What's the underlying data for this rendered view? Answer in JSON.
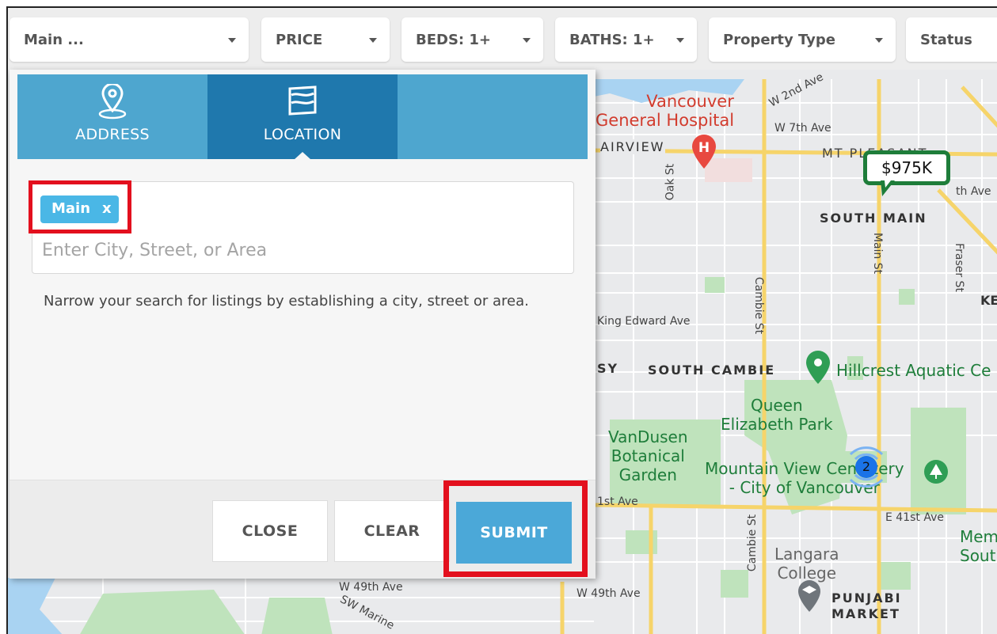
{
  "filters": {
    "location_label": "Main ...",
    "price_label": "PRICE",
    "beds_label": "BEDS: 1+",
    "baths_label": "BATHS: 1+",
    "property_type_label": "Property Type",
    "status_label": "Status"
  },
  "panel": {
    "tabs": [
      {
        "label": "ADDRESS",
        "icon": "map-pin-icon",
        "active": false
      },
      {
        "label": "LOCATION",
        "icon": "map-fold-icon",
        "active": true
      }
    ],
    "chip": {
      "label": "Main",
      "remove": "x"
    },
    "search_placeholder": "Enter City, Street, or Area",
    "help_text": "Narrow your search for listings by establishing a city, street or area.",
    "buttons": {
      "close": "CLOSE",
      "clear": "CLEAR",
      "submit": "SUBMIT"
    }
  },
  "map": {
    "labels": {
      "vgh_line1": "Vancouver",
      "vgh_line2": "General Hospital",
      "fairview": "AIRVIEW",
      "w2nd": "W 2nd Ave",
      "w7th": "W 7th Ave",
      "mt_pleasant": "MT PLEASANT",
      "oak_st": "Oak St",
      "south_main": "SOUTH MAIN",
      "th_ave": "th Ave",
      "main_st": "Main St",
      "fraser_st": "Fraser St",
      "ke": "KE",
      "cambie_st": "Cambie St",
      "king_edward": "King Edward Ave",
      "sy": "SY",
      "south_cambie": "SOUTH CAMBIE",
      "hillcrest": "Hillcrest Aquatic Ce",
      "queen_line1": "Queen",
      "queen_line2": "Elizabeth Park",
      "vandusen_line1": "VanDusen",
      "vandusen_line2": "Botanical",
      "vandusen_line3": "Garden",
      "mv_line1": "Mountain View Cemetery",
      "mv_line2": "- City of Vancouver",
      "st_ave": "1st Ave",
      "e41st": "E 41st Ave",
      "cambie_st2": "Cambie St",
      "langara_line1": "Langara",
      "langara_line2": "College",
      "mem": "Mem",
      "south": "South",
      "w49th_left": "W 49th Ave",
      "w49th_right": "W 49th Ave",
      "sw_marine": "SW Marine",
      "punjabi_line1": "PUNJABI",
      "punjabi_line2": "MARKET"
    },
    "price_pin": "$975K",
    "cluster_count": "2",
    "colors": {
      "park": "#bfe3bc",
      "road": "#f6d46a",
      "water": "#a9d3f2",
      "pin_green": "#1e7d3a",
      "cluster_blue": "#1a73e8"
    }
  },
  "colors": {
    "tab_bar": "#4ea6cf",
    "tab_active": "#1f78ad",
    "chip": "#4ab7e6",
    "submit": "#4ba8d8",
    "highlight": "#e3101e"
  }
}
